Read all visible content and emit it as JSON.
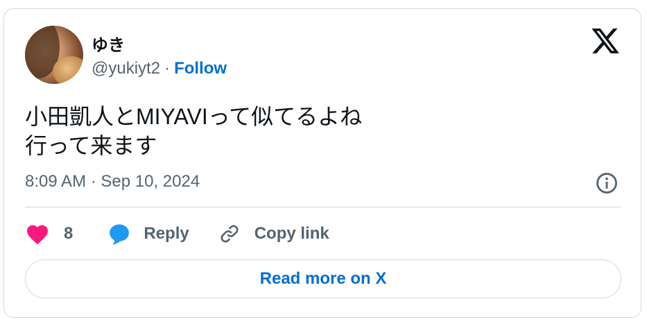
{
  "author": {
    "display_name": "ゆき",
    "handle": "@yukiyt2",
    "separator": "·",
    "follow_label": "Follow"
  },
  "tweet": {
    "text": "小田凱人とMIYAVIって似てるよね\n行って来ます",
    "timestamp": "8:09 AM · Sep 10, 2024"
  },
  "actions": {
    "like_count": "8",
    "reply_label": "Reply",
    "copy_link_label": "Copy link"
  },
  "read_more_label": "Read more on X",
  "colors": {
    "like": "#f91880",
    "reply": "#1d9bf0",
    "link": "#006fd6",
    "muted": "#536471"
  },
  "icons": [
    "x-logo-icon",
    "info-icon",
    "heart-icon",
    "reply-bubble-icon",
    "link-icon"
  ]
}
